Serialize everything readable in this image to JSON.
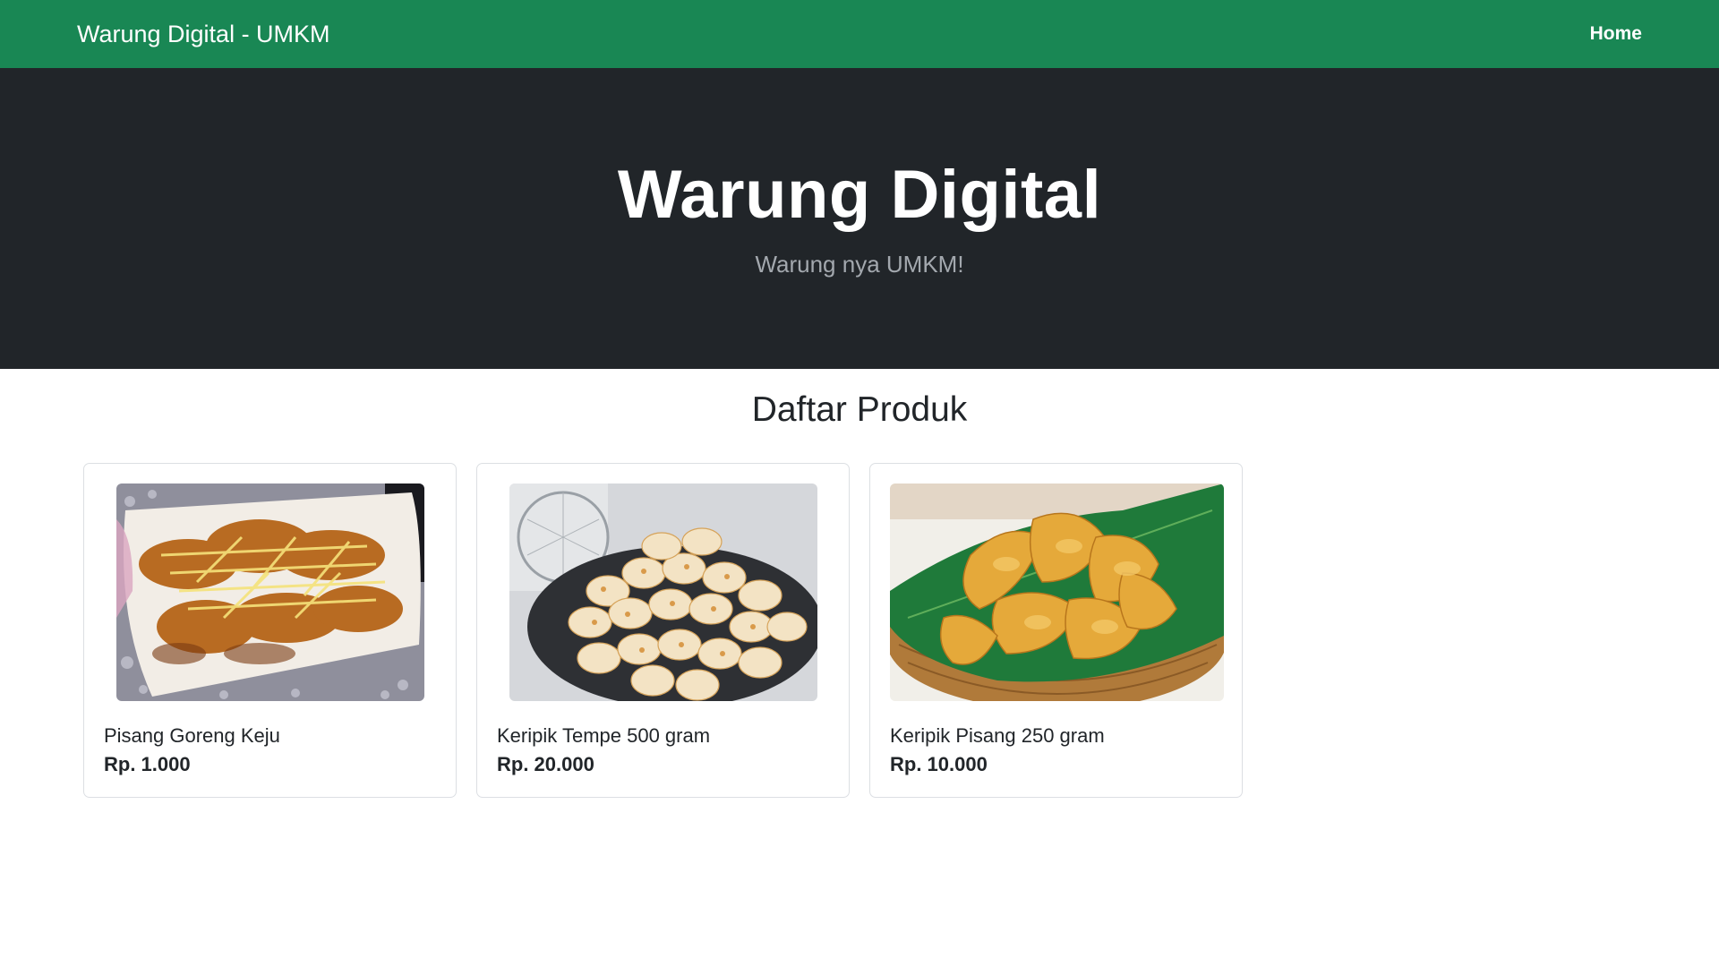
{
  "navbar": {
    "brand": "Warung Digital - UMKM",
    "links": [
      {
        "label": "Home"
      }
    ]
  },
  "hero": {
    "title": "Warung Digital",
    "subtitle": "Warung nya UMKM!"
  },
  "section": {
    "title": "Daftar Produk"
  },
  "products": [
    {
      "name": "Pisang Goreng Keju",
      "price": "Rp. 1.000",
      "image": "fried-banana-cheese-photo"
    },
    {
      "name": "Keripik Tempe 500 gram",
      "price": "Rp. 20.000",
      "image": "tempe-chips-photo"
    },
    {
      "name": "Keripik Pisang 250 gram",
      "price": "Rp. 10.000",
      "image": "banana-chips-photo"
    }
  ],
  "colors": {
    "navbar": "#198754",
    "hero": "#212529",
    "text": "#212529"
  }
}
